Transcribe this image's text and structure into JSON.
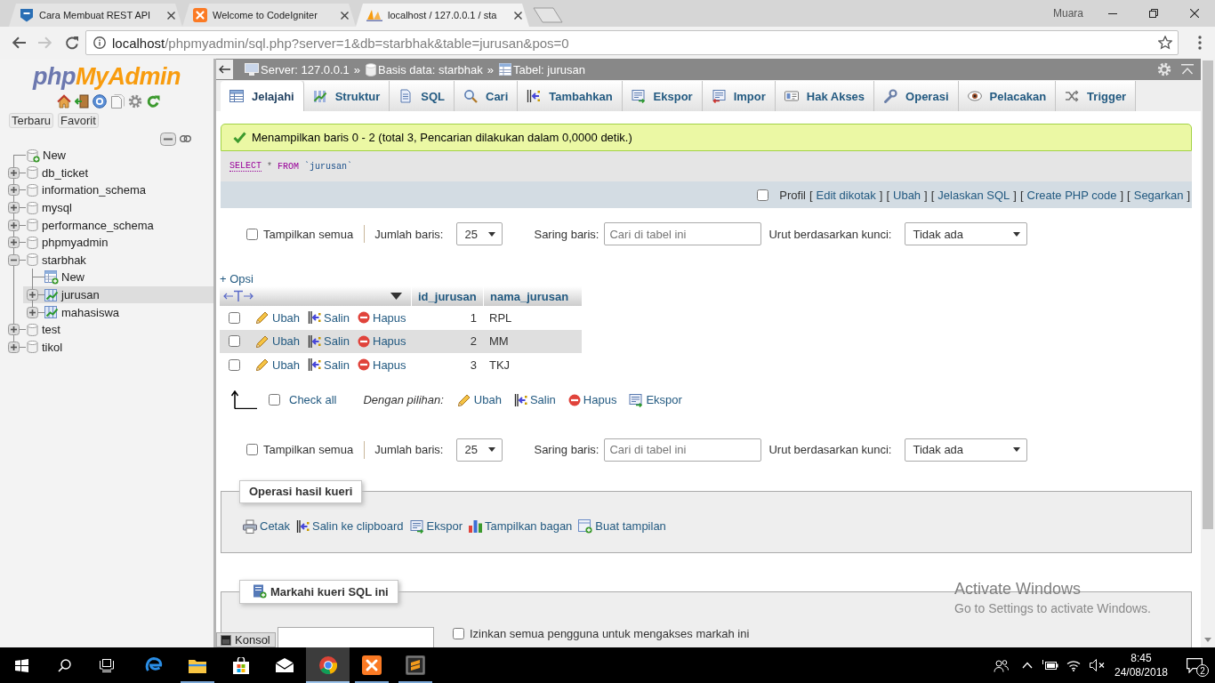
{
  "browser": {
    "tabs": [
      {
        "title": "Cara Membuat REST API",
        "kind": "shield",
        "selected": false
      },
      {
        "title": "Welcome to CodeIgniter",
        "kind": "tile",
        "selected": false
      },
      {
        "title": "localhost / 127.0.0.1 / sta",
        "kind": "sail",
        "selected": true
      }
    ],
    "profile": "Muara",
    "nav": [
      {
        "kind": "back",
        "disabled": false
      },
      {
        "kind": "forward",
        "disabled": true
      },
      {
        "kind": "reload",
        "disabled": false
      }
    ],
    "address": {
      "host": "localhost",
      "path": "/phpmyadmin/sql.php?server=1&db=starbhak&table=jurusan&pos=0"
    }
  },
  "sidebar": {
    "logo": {
      "prefix": "php",
      "name": "MyAdmin"
    },
    "buttons": [
      "Terbaru",
      "Favorit"
    ],
    "tree": [
      {
        "label": "New",
        "kind": "newdb",
        "selected": false
      },
      {
        "label": "db_ticket",
        "kind": "database",
        "expanded": false,
        "selected": false
      },
      {
        "label": "information_schema",
        "kind": "database",
        "expanded": false,
        "selected": false
      },
      {
        "label": "mysql",
        "kind": "database",
        "expanded": false,
        "selected": false
      },
      {
        "label": "performance_schema",
        "kind": "database",
        "expanded": false,
        "selected": false
      },
      {
        "label": "phpmyadmin",
        "kind": "database",
        "expanded": false,
        "selected": false
      },
      {
        "label": "starbhak",
        "kind": "database",
        "expanded": true,
        "selected": false,
        "children": [
          {
            "label": "New",
            "kind": "newtable",
            "selected": false
          },
          {
            "label": "jurusan",
            "kind": "table",
            "expanded": false,
            "selected": true
          },
          {
            "label": "mahasiswa",
            "kind": "table",
            "expanded": false,
            "selected": false
          }
        ]
      },
      {
        "label": "test",
        "kind": "database",
        "expanded": false,
        "selected": false
      },
      {
        "label": "tikol",
        "kind": "database",
        "expanded": false,
        "selected": false
      }
    ]
  },
  "main": {
    "breadcrumb": [
      {
        "label": "Server: 127.0.0.1",
        "kind": "server",
        "separator": "»"
      },
      {
        "label": "Basis data: starbhak",
        "kind": "database",
        "separator": "»"
      },
      {
        "label": "Tabel: jurusan",
        "kind": "table"
      }
    ],
    "tabs": [
      {
        "label": "Jelajahi",
        "kind": "browse",
        "selected": true
      },
      {
        "label": "Struktur",
        "kind": "structure",
        "selected": false
      },
      {
        "label": "SQL",
        "kind": "sql",
        "selected": false
      },
      {
        "label": "Cari",
        "kind": "search",
        "selected": false
      },
      {
        "label": "Tambahkan",
        "kind": "insert",
        "selected": false
      },
      {
        "label": "Ekspor",
        "kind": "export",
        "selected": false
      },
      {
        "label": "Impor",
        "kind": "import",
        "selected": false
      },
      {
        "label": "Hak Akses",
        "kind": "privileges",
        "selected": false
      },
      {
        "label": "Operasi",
        "kind": "operations",
        "selected": false
      },
      {
        "label": "Pelacakan",
        "kind": "tracking",
        "selected": false
      },
      {
        "label": "Trigger",
        "kind": "triggers",
        "selected": false
      }
    ],
    "message": "Menampilkan baris 0 - 2 (total 3, Pencarian dilakukan dalam 0,0000 detik.)",
    "sql": [
      {
        "text": "SELECT",
        "kind": "link"
      },
      {
        "text": "*",
        "kind": "operator"
      },
      {
        "text": "FROM",
        "kind": "keyword"
      },
      {
        "text": "`jurusan`",
        "kind": "identifier"
      }
    ],
    "profiling": {
      "label": "Profil",
      "checked": false
    },
    "query_links": [
      {
        "label": "Edit dikotak",
        "open": "[",
        "close": "]"
      },
      {
        "label": "Ubah",
        "open": "[",
        "close": "]"
      },
      {
        "label": "Jelaskan SQL",
        "open": "[",
        "close": "]"
      },
      {
        "label": "Create PHP code",
        "open": "[",
        "close": "]"
      },
      {
        "label": "Segarkan",
        "open": "[",
        "close": "]"
      }
    ],
    "navigation": [
      {
        "show_all": {
          "label": "Tampilkan semua",
          "checked": false
        },
        "rows_label": "Jumlah baris:",
        "rows_value": "25",
        "filter_label": "Saring baris:",
        "filter_placeholder": "Cari di tabel ini",
        "sort_label": "Urut berdasarkan kunci:",
        "sort_value": "Tidak ada"
      },
      {
        "show_all": {
          "label": "Tampilkan semua",
          "checked": false
        },
        "rows_label": "Jumlah baris:",
        "rows_value": "25",
        "filter_label": "Saring baris:",
        "filter_placeholder": "Cari di tabel ini",
        "sort_label": "Urut berdasarkan kunci:",
        "sort_value": "Tidak ada"
      }
    ],
    "options_toggle": "+ Opsi",
    "table": {
      "columns": [
        "id_jurusan",
        "nama_jurusan"
      ],
      "rows": [
        {
          "checked": false,
          "actions": [
            {
              "kind": "edit",
              "label": "Ubah"
            },
            {
              "kind": "copy",
              "label": "Salin"
            },
            {
              "kind": "delete",
              "label": "Hapus"
            }
          ],
          "cells": [
            "1",
            "RPL"
          ]
        },
        {
          "checked": false,
          "actions": [
            {
              "kind": "edit",
              "label": "Ubah"
            },
            {
              "kind": "copy",
              "label": "Salin"
            },
            {
              "kind": "delete",
              "label": "Hapus"
            }
          ],
          "cells": [
            "2",
            "MM"
          ]
        },
        {
          "checked": false,
          "actions": [
            {
              "kind": "edit",
              "label": "Ubah"
            },
            {
              "kind": "copy",
              "label": "Salin"
            },
            {
              "kind": "delete",
              "label": "Hapus"
            }
          ],
          "cells": [
            "3",
            "TKJ"
          ]
        }
      ]
    },
    "bulk": {
      "check_all": {
        "label": "Check all",
        "checked": false
      },
      "with_selected": "Dengan pilihan:",
      "actions": [
        {
          "kind": "edit",
          "label": "Ubah"
        },
        {
          "kind": "copy",
          "label": "Salin"
        },
        {
          "kind": "delete",
          "label": "Hapus"
        },
        {
          "kind": "export",
          "label": "Ekspor"
        }
      ]
    },
    "result_operations": {
      "legend": "Operasi hasil kueri",
      "links": [
        {
          "kind": "print",
          "label": "Cetak"
        },
        {
          "kind": "copy",
          "label": "Salin ke clipboard"
        },
        {
          "kind": "export",
          "label": "Ekspor"
        },
        {
          "kind": "chart",
          "label": "Tampilkan bagan"
        },
        {
          "kind": "view",
          "label": "Buat tampilan"
        }
      ]
    },
    "bookmark": {
      "legend": "Markahi kueri SQL ini",
      "share": {
        "label": "Izinkan semua pengguna untuk mengakses markah ini",
        "checked": false
      }
    },
    "console": "Konsol"
  },
  "watermark": {
    "title": "Activate Windows",
    "hint": "Go to Settings to activate Windows."
  },
  "taskbar": {
    "apps": [
      {
        "kind": "swirl",
        "running": false,
        "selected": false
      },
      {
        "kind": "folder",
        "running": true,
        "selected": false
      },
      {
        "kind": "bag",
        "running": false,
        "selected": false
      },
      {
        "kind": "envelope",
        "running": false,
        "selected": false
      },
      {
        "kind": "wheel",
        "running": true,
        "selected": true
      },
      {
        "kind": "tile",
        "running": true,
        "selected": false
      },
      {
        "kind": "slate",
        "running": true,
        "selected": false
      }
    ],
    "time": "8:45",
    "date": "24/08/2018",
    "notifications": "2"
  }
}
